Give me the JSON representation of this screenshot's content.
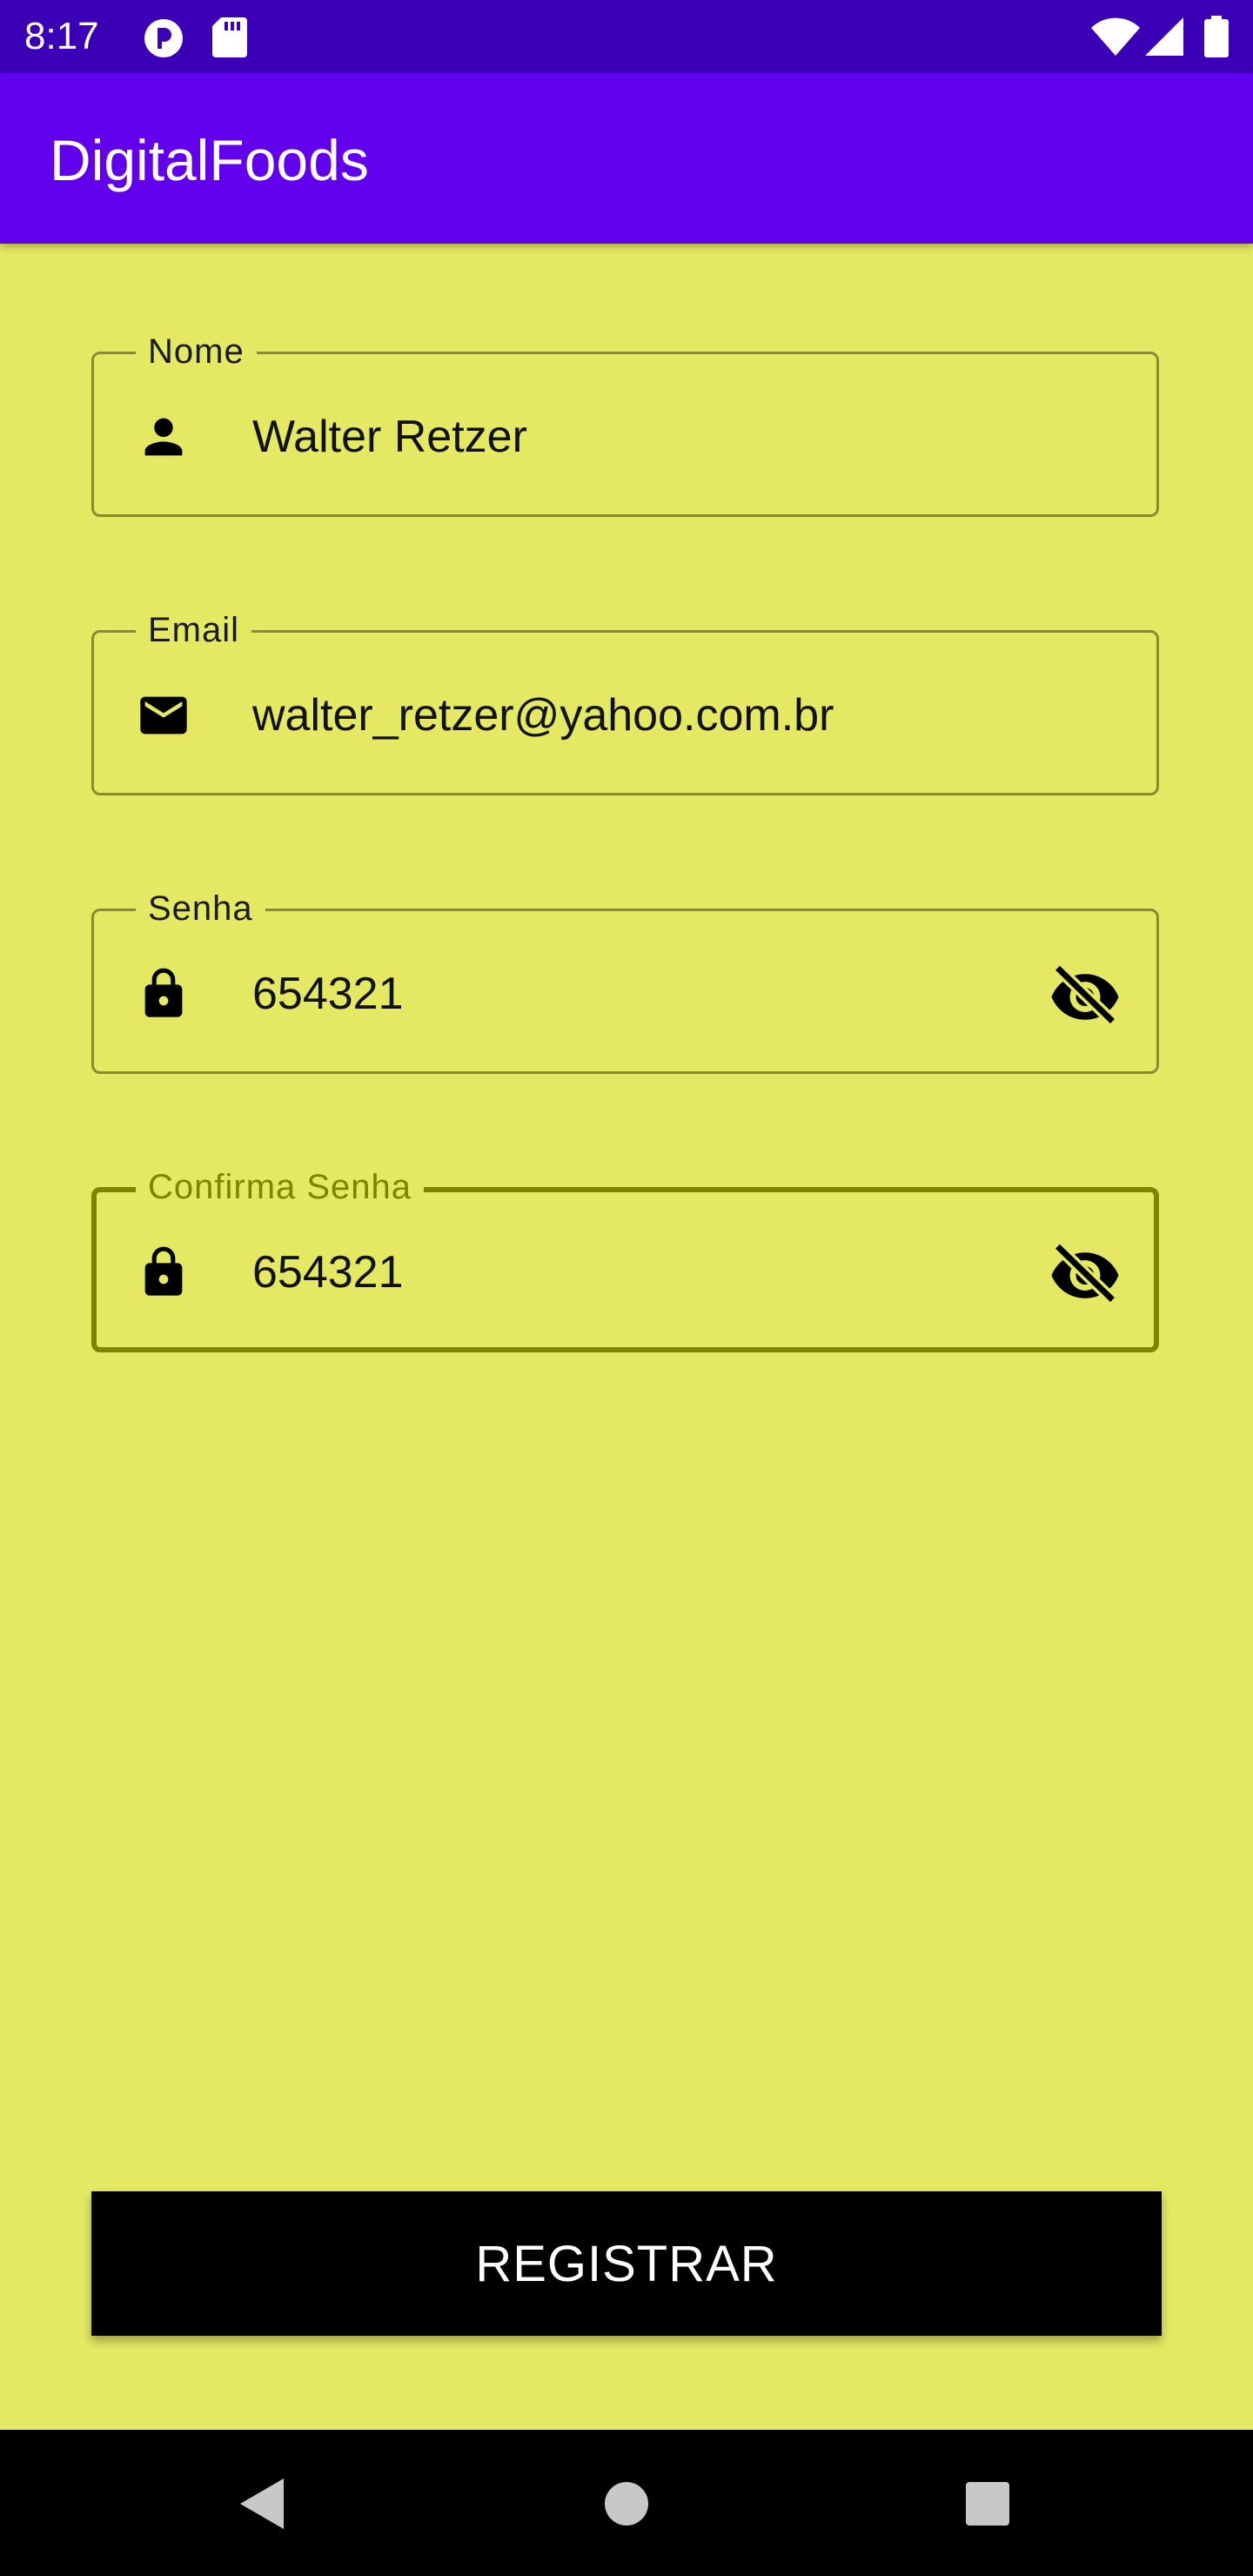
{
  "status_bar": {
    "time": "8:17",
    "icons": [
      "p-circle-icon",
      "sd-card-icon",
      "wifi-icon",
      "signal-icon",
      "battery-icon"
    ]
  },
  "app_bar": {
    "title": "DigitalFoods"
  },
  "form": {
    "name": {
      "label": "Nome",
      "value": "Walter Retzer",
      "icon": "person-icon"
    },
    "email": {
      "label": "Email",
      "value": "walter_retzer@yahoo.com.br",
      "icon": "mail-icon"
    },
    "password": {
      "label": "Senha",
      "value": "654321",
      "icon": "lock-icon",
      "trailing_icon": "visibility-off-icon"
    },
    "confirm_password": {
      "label": "Confirma Senha",
      "value": "654321",
      "icon": "lock-icon",
      "trailing_icon": "visibility-off-icon"
    }
  },
  "register_button": {
    "label": "REGISTRAR"
  },
  "nav_bar": {
    "icons": [
      "back-icon",
      "home-icon",
      "recents-icon"
    ]
  },
  "colors": {
    "background": "#E4E862",
    "status_bar": "#3B00B5",
    "app_bar": "#6200EE",
    "focused_outline": "#7E8400",
    "button": "#000000"
  }
}
